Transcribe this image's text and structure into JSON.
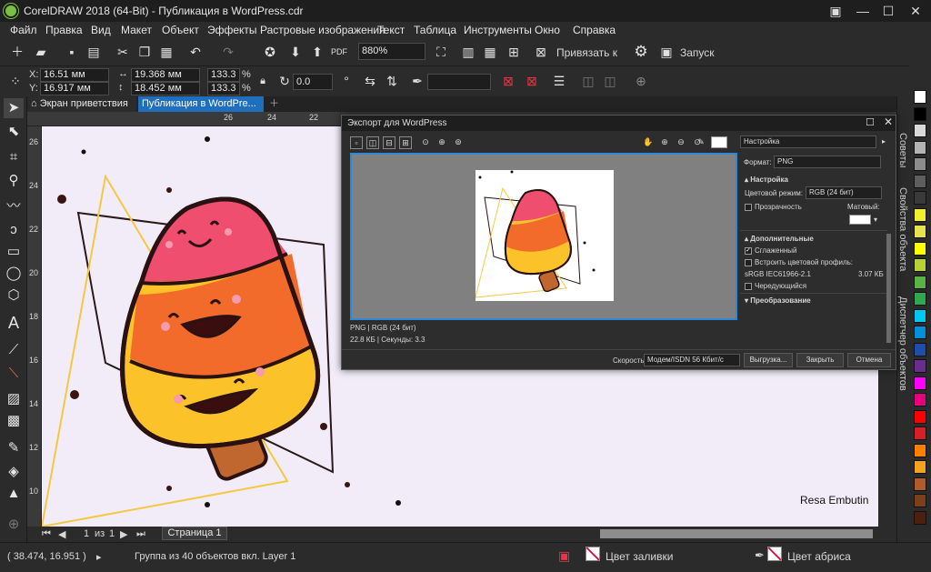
{
  "window": {
    "title": "CorelDRAW 2018 (64-Bit) - Публикация в WordPress.cdr"
  },
  "menu": [
    "Файл",
    "Правка",
    "Вид",
    "Макет",
    "Объект",
    "Эффекты",
    "Растровые изображения",
    "Текст",
    "Таблица",
    "Инструменты",
    "Окно",
    "Справка"
  ],
  "toolbar": {
    "zoom": "880%",
    "snap_label": "Привязать к",
    "launch_label": "Запуск"
  },
  "props": {
    "x": "16.51 мм",
    "y": "16.917 мм",
    "w": "19.368 мм",
    "h": "18.452 мм",
    "scale_w": "133.3",
    "scale_h": "133.3",
    "pct1": "%",
    "pct2": "%",
    "angle": "0.0",
    "x_label": "X:",
    "y_label": "Y:"
  },
  "tabs": {
    "welcome": "Экран приветствия",
    "doc": "Публикация в WordPre..."
  },
  "ruler": {
    "h": [
      "26",
      "24",
      "22"
    ],
    "v": [
      "26",
      "24",
      "22",
      "20",
      "18",
      "16",
      "14",
      "12",
      "10"
    ]
  },
  "canvas": {
    "signature": "Resa Embutin"
  },
  "page_nav": {
    "current": "1",
    "of": "из",
    "total": "1",
    "page_tab": "Страница 1"
  },
  "dialog": {
    "title": "Экспорт для WordPress",
    "preset": "Настройка",
    "format_label": "Формат:",
    "format_value": "PNG",
    "section_settings": "Настройка",
    "color_mode_label": "Цветовой режим:",
    "color_mode_value": "RGB (24 бит)",
    "transparency": "Прозрачность",
    "matte": "Матовый:",
    "section_extra": "Дополнительные",
    "antialias": "Сглаженный",
    "embed_profile": "Встроить цветовой профиль:",
    "profile_name": "sRGB IEC61966-2.1",
    "profile_size": "3.07 КБ",
    "interlaced": "Чередующийся",
    "section_transform": "Преобразование",
    "info_line1": "PNG  |  RGB (24 бит)",
    "info_line2": "22.8 КБ  |  Секунды: 3.3",
    "speed_label": "Скорость:",
    "speed_value": "Модем/ISDN 56 Кбит/с",
    "export_btn": "Выгрузка...",
    "close_btn": "Закрыть",
    "cancel_btn": "Отмена"
  },
  "dockers": {
    "hints": "Советы",
    "props": "Свойства объекта",
    "manager": "Диспетчер объектов"
  },
  "status": {
    "coords": "( 38.474, 16.951 )",
    "selection": "Группа из 40 объектов вкл. Layer 1",
    "fill": "Цвет заливки",
    "outline": "Цвет абриса"
  },
  "palette": [
    "#ffffff",
    "#000000",
    "#d9d9d9",
    "#b3b3b3",
    "#8c8c8c",
    "#5e5e5e",
    "#3a3a3a",
    "#f2ef2d",
    "#e7e34c",
    "#ffff00",
    "#b5d334",
    "#5bb246",
    "#2fa84f",
    "#00c8f0",
    "#0090d8",
    "#1d4fa8",
    "#6a2d8f",
    "#ff00ff",
    "#e6007e",
    "#ff0000",
    "#d62028",
    "#ff7f00",
    "#f4a31f",
    "#b05c2a",
    "#7b3f1a",
    "#4d1f0e"
  ],
  "colors": {
    "canvas": "#f1ecf8",
    "accent": "#2f87d6",
    "pink": "#ef4e6e",
    "orange": "#f26b2a",
    "yellow": "#fbc22a",
    "stick": "#c0672f"
  }
}
